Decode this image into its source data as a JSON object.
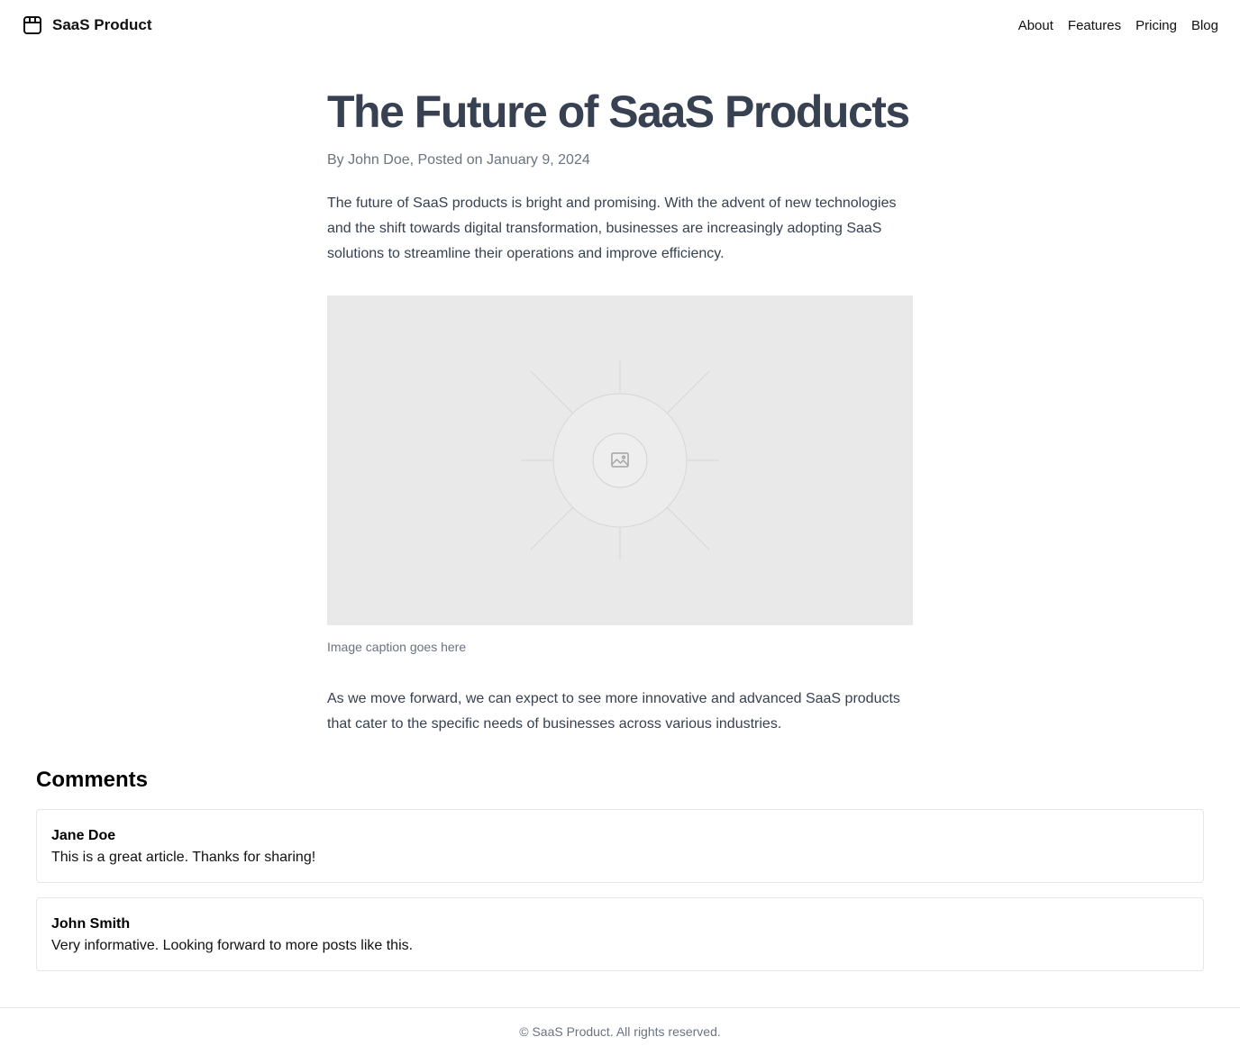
{
  "header": {
    "brand_name": "SaaS Product",
    "brand_icon": "package-icon",
    "nav": [
      "About",
      "Features",
      "Pricing",
      "Blog"
    ]
  },
  "article": {
    "title": "The Future of SaaS Products",
    "meta": "By John Doe, Posted on January 9, 2024",
    "paragraph_1": "The future of SaaS products is bright and promising. With the advent of new technologies and the shift towards digital transformation, businesses are increasingly adopting SaaS solutions to streamline their operations and improve efficiency.",
    "image_icon": "image-placeholder-icon",
    "caption": "Image caption goes here",
    "paragraph_2": "As we move forward, we can expect to see more innovative and advanced SaaS products that cater to the specific needs of businesses across various industries."
  },
  "comments": {
    "title": "Comments",
    "items": [
      {
        "author": "Jane Doe",
        "text": "This is a great article. Thanks for sharing!"
      },
      {
        "author": "John Smith",
        "text": "Very informative. Looking forward to more posts like this."
      }
    ]
  },
  "footer": {
    "text": "© SaaS Product. All rights reserved."
  },
  "colors": {
    "title": "#374151",
    "muted": "#6b7280",
    "body": "#374151",
    "border": "#e5e7eb",
    "placeholder_bg": "#e9e9e9"
  }
}
